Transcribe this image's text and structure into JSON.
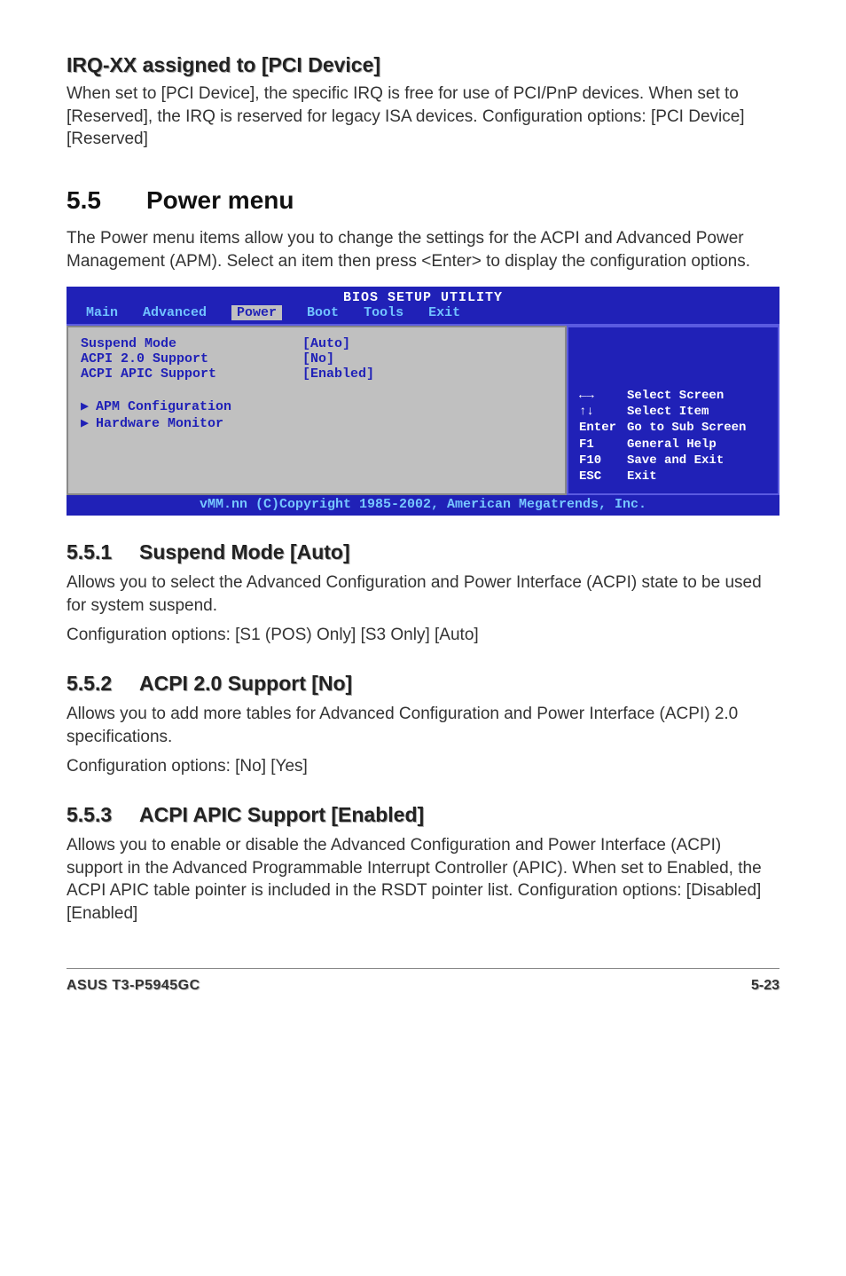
{
  "irq": {
    "heading": "IRQ-XX assigned to [PCI Device]",
    "text": "When set to [PCI Device], the specific IRQ is free for use of PCI/PnP devices. When set to [Reserved], the IRQ is reserved for legacy ISA devices. Configuration options: [PCI Device] [Reserved]"
  },
  "power": {
    "num": "5.5",
    "title": "Power menu",
    "intro": "The Power menu items allow you to change the settings for the ACPI and Advanced Power Management (APM). Select an item then press <Enter> to display the configuration options."
  },
  "bios": {
    "title": "BIOS SETUP UTILITY",
    "tabs": {
      "main": "Main",
      "advanced": "Advanced",
      "power": "Power",
      "boot": "Boot",
      "tools": "Tools",
      "exit": "Exit"
    },
    "rows": [
      {
        "label": "Suspend Mode",
        "value": "[Auto]"
      },
      {
        "label": "ACPI 2.0 Support",
        "value": "[No]"
      },
      {
        "label": "ACPI APIC Support",
        "value": "[Enabled]"
      }
    ],
    "subs": [
      "APM Configuration",
      "Hardware Monitor"
    ],
    "help": [
      {
        "k": "←→",
        "v": "Select Screen"
      },
      {
        "k": "↑↓",
        "v": "Select Item"
      },
      {
        "k": "Enter",
        "v": "Go to Sub Screen"
      },
      {
        "k": "F1",
        "v": "General Help"
      },
      {
        "k": "F10",
        "v": "Save and Exit"
      },
      {
        "k": "ESC",
        "v": "Exit"
      }
    ],
    "footer": "vMM.nn (C)Copyright 1985-2002, American Megatrends, Inc."
  },
  "s551": {
    "num": "5.5.1",
    "title": "Suspend Mode [Auto]",
    "p1": "Allows you to select the Advanced Configuration and Power Interface (ACPI) state to be used for system suspend.",
    "p2": "Configuration options: [S1 (POS) Only] [S3 Only] [Auto]"
  },
  "s552": {
    "num": "5.5.2",
    "title": "ACPI 2.0 Support [No]",
    "p1": "Allows you to add more tables for Advanced Configuration and Power Interface (ACPI) 2.0 specifications.",
    "p2": "Configuration options: [No] [Yes]"
  },
  "s553": {
    "num": "5.5.3",
    "title": "ACPI APIC Support [Enabled]",
    "p1": "Allows you to enable or disable the Advanced Configuration and Power Interface (ACPI) support in the Advanced Programmable Interrupt Controller (APIC). When set to Enabled, the ACPI APIC table pointer is included in the RSDT pointer list. Configuration options: [Disabled] [Enabled]"
  },
  "footer": {
    "left": "ASUS T3-P5945GC",
    "right": "5-23"
  }
}
